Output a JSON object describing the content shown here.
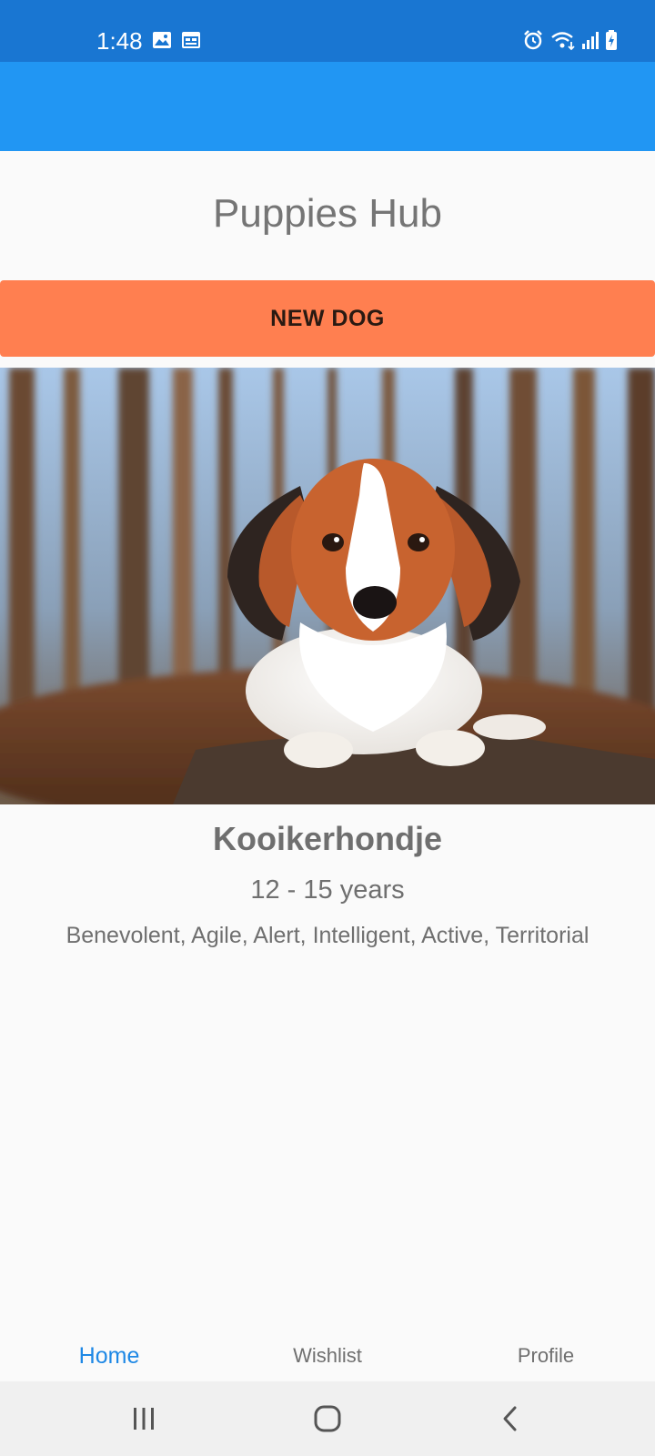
{
  "status_bar": {
    "time": "1:48",
    "icons": [
      "image-icon",
      "calendar-icon",
      "alarm-icon",
      "wifi-icon",
      "signal-icon",
      "battery-icon"
    ]
  },
  "app": {
    "title": "Puppies Hub",
    "new_dog_label": "NEW DOG"
  },
  "dog": {
    "breed": "Kooikerhondje",
    "lifespan": "12 - 15 years",
    "temperament": "Benevolent, Agile, Alert, Intelligent, Active, Territorial"
  },
  "bottom_nav": {
    "items": [
      {
        "label": "Home",
        "active": true
      },
      {
        "label": "Wishlist",
        "active": false
      },
      {
        "label": "Profile",
        "active": false
      }
    ]
  },
  "colors": {
    "status_bar": "#1976d2",
    "app_bar": "#2196f3",
    "button": "#ff7f50",
    "active_nav": "#1e88e5"
  }
}
